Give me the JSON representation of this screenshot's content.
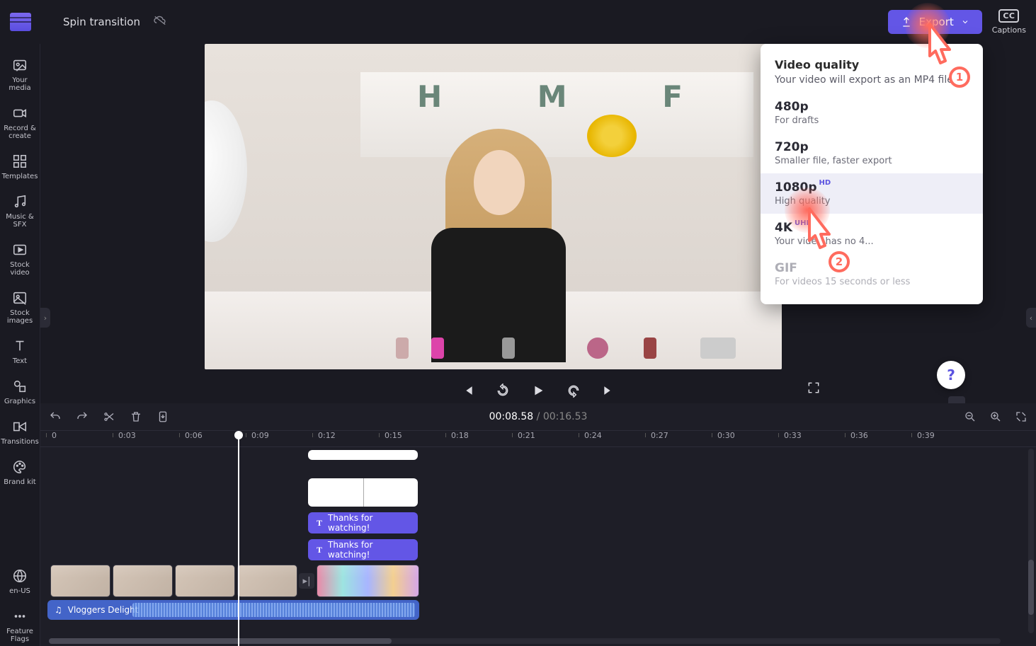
{
  "header": {
    "title": "Spin transition",
    "export_label": "Export",
    "captions_label": "Captions"
  },
  "rail": [
    {
      "label": "Your media",
      "icon": "image-folder"
    },
    {
      "label": "Record & create",
      "icon": "camera"
    },
    {
      "label": "Templates",
      "icon": "grid"
    },
    {
      "label": "Music & SFX",
      "icon": "music"
    },
    {
      "label": "Stock video",
      "icon": "playbox"
    },
    {
      "label": "Stock images",
      "icon": "picture"
    },
    {
      "label": "Text",
      "icon": "text"
    },
    {
      "label": "Graphics",
      "icon": "shapes"
    },
    {
      "label": "Transitions",
      "icon": "transition"
    },
    {
      "label": "Brand kit",
      "icon": "palette"
    }
  ],
  "rail_bottom": [
    {
      "label": "en-US",
      "icon": "globe"
    },
    {
      "label": "Feature Flags",
      "icon": "dots"
    }
  ],
  "export_menu": {
    "heading": "Video quality",
    "description": "Your video will export as an MP4 file",
    "options": [
      {
        "quality": "480p",
        "badge": "",
        "desc": "For drafts"
      },
      {
        "quality": "720p",
        "badge": "",
        "desc": "Smaller file, faster export"
      },
      {
        "quality": "1080p",
        "badge": "HD",
        "desc": "High quality"
      },
      {
        "quality": "4K",
        "badge": "UHD",
        "desc": "Your video has no 4..."
      },
      {
        "quality": "GIF",
        "badge": "",
        "desc": "For videos 15 seconds or less"
      }
    ]
  },
  "pointers": {
    "one": "1",
    "two": "2"
  },
  "playback": {
    "current": "00:08.58",
    "separator": "/",
    "total": "00:16.53"
  },
  "ruler": [
    "0",
    "0:03",
    "0:06",
    "0:09",
    "0:12",
    "0:15",
    "0:18",
    "0:21",
    "0:24",
    "0:27",
    "0:30",
    "0:33",
    "0:36",
    "0:39"
  ],
  "text_clips": {
    "a": "Thanks for watching!",
    "b": "Thanks for watching!"
  },
  "audio": {
    "name": "Vloggers Delight"
  },
  "preview_letters": "H M F"
}
